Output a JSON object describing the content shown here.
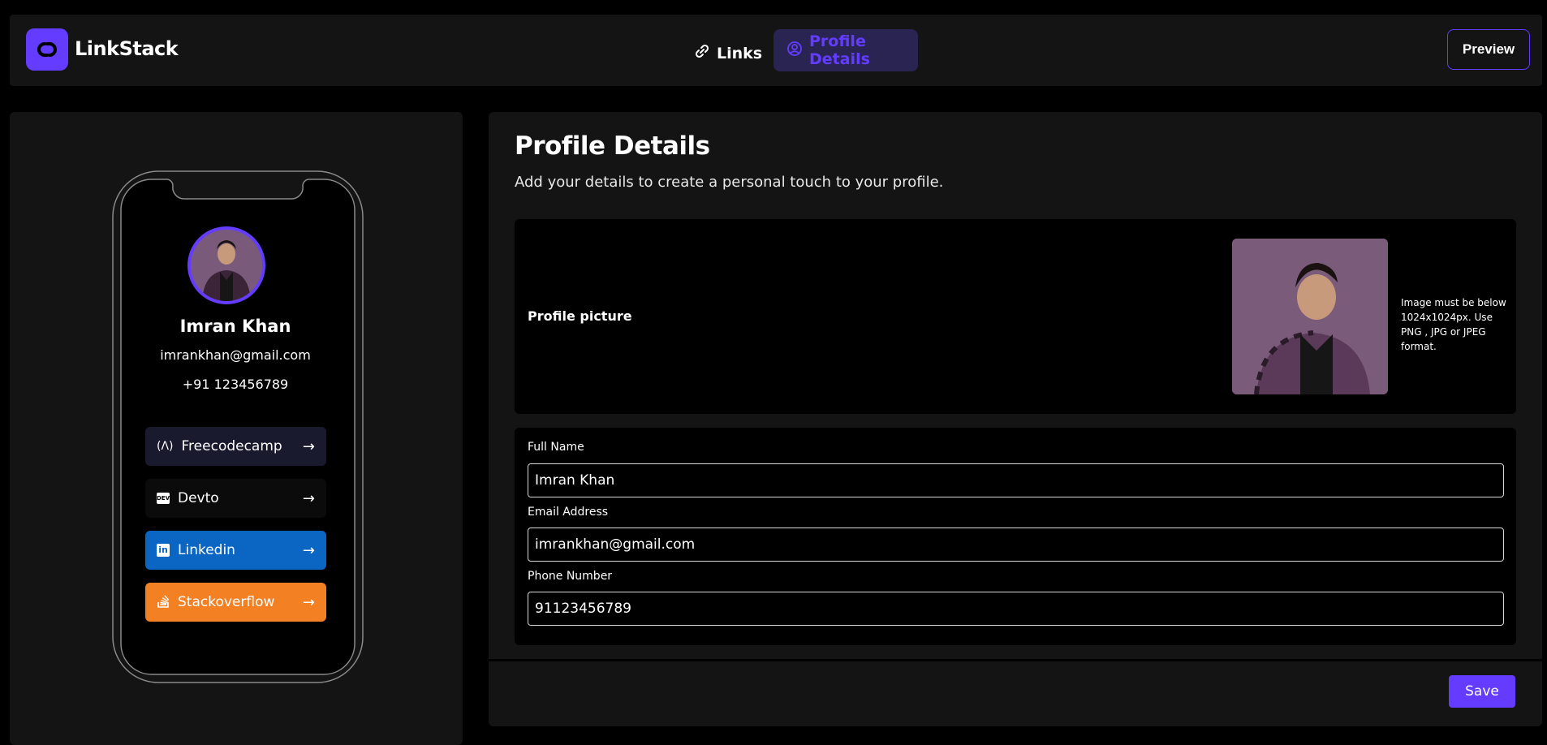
{
  "app": {
    "name": "LinkStack"
  },
  "nav": {
    "links_label": "Links",
    "profile_label": "Profile Details",
    "preview_label": "Preview"
  },
  "preview": {
    "name": "Imran Khan",
    "email": "imrankhan@gmail.com",
    "phone": "+91 123456789",
    "links": [
      {
        "label": "Freecodecamp",
        "icon": "freecodecamp-icon",
        "color": "#1a1a2e"
      },
      {
        "label": "Devto",
        "icon": "devto-icon",
        "color": "#0b0b0b"
      },
      {
        "label": "Linkedin",
        "icon": "linkedin-icon",
        "color": "#0a66c2"
      },
      {
        "label": "Stackoverflow",
        "icon": "stackoverflow-icon",
        "color": "#f48024"
      }
    ]
  },
  "profile": {
    "title": "Profile Details",
    "subtitle": "Add your details to create a personal touch to your profile.",
    "picture_label": "Profile picture",
    "picture_note": "Image must be below 1024x1024px. Use PNG , JPG or JPEG format.",
    "fields": {
      "full_name_label": "Full Name",
      "full_name_value": "Imran Khan",
      "email_label": "Email Address",
      "email_value": "imrankhan@gmail.com",
      "phone_label": "Phone Number",
      "phone_value": "91123456789"
    },
    "save_label": "Save"
  },
  "colors": {
    "accent": "#633cff",
    "panel": "#141414",
    "background": "#000000"
  }
}
